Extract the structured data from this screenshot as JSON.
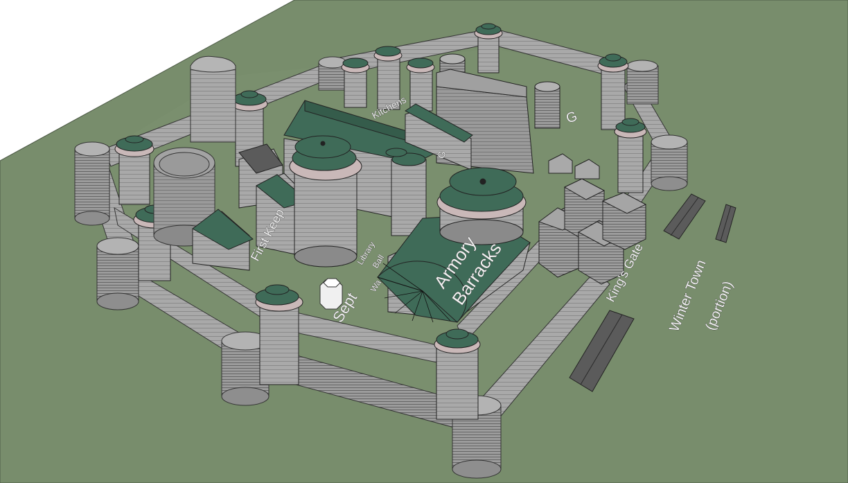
{
  "labels": {
    "first_keep": "First Keep",
    "kitchens": "Kitchens",
    "library": "Library",
    "ball": "Ball",
    "wall": "Wa",
    "sept": "Sept",
    "armory": "Armory",
    "barracks": "Barracks",
    "kings_gate": "King's Gate",
    "winter_town": "Winter Town",
    "winter_town_sub": "(portion)",
    "glass": "G",
    "guest": "G"
  },
  "colors": {
    "ground": "#788d6c",
    "wall": "#a9a9a9",
    "wall_dark": "#8e8e8e",
    "roof": "#3f6b58",
    "building_dark": "#5b5b5b",
    "sept": "#f0f0f0"
  }
}
